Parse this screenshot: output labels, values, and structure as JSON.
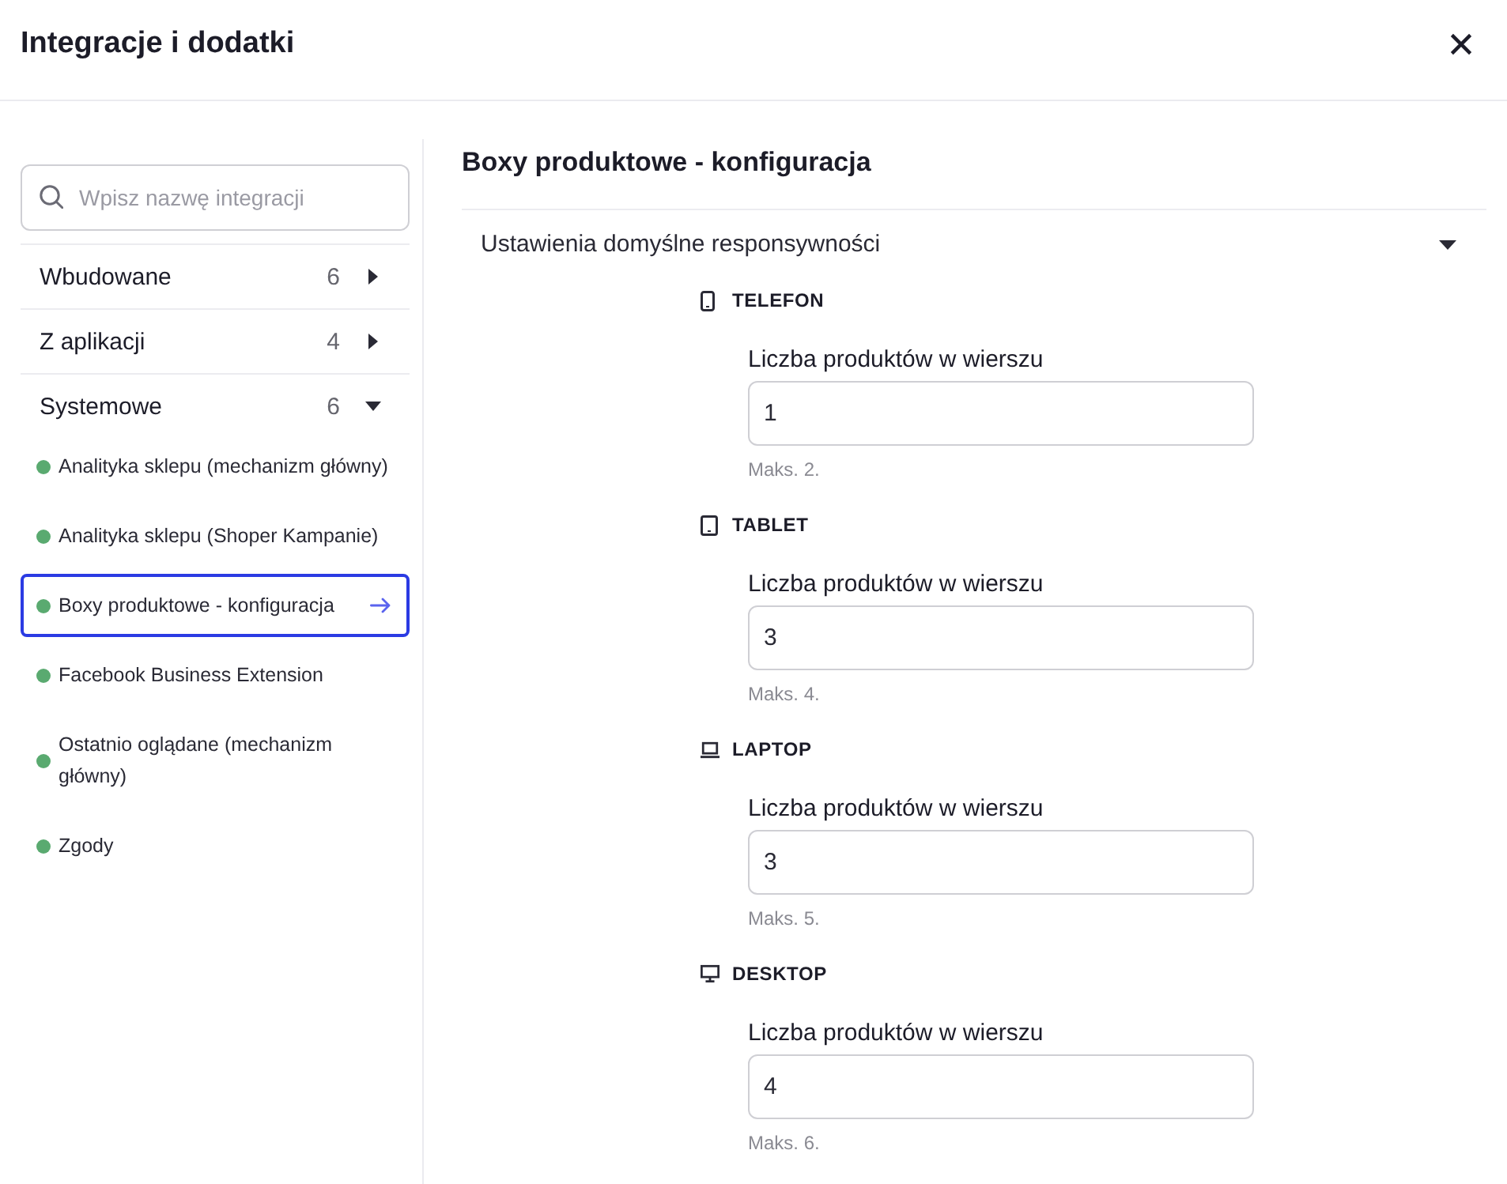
{
  "window": {
    "title": "Integracje i dodatki"
  },
  "sidebar": {
    "search": {
      "placeholder": "Wpisz nazwę integracji"
    },
    "categories": [
      {
        "label": "Wbudowane",
        "count": "6",
        "expanded": false
      },
      {
        "label": "Z aplikacji",
        "count": "4",
        "expanded": false
      },
      {
        "label": "Systemowe",
        "count": "6",
        "expanded": true,
        "children": [
          {
            "label": "Analityka sklepu (mechanizm główny)",
            "selected": false
          },
          {
            "label": "Analityka sklepu (Shoper Kampanie)",
            "selected": false
          },
          {
            "label": "Boxy produktowe - konfiguracja",
            "selected": true
          },
          {
            "label": "Facebook Business Extension",
            "selected": false
          },
          {
            "label": "Ostatnio oglądane (mechanizm główny)",
            "selected": false
          },
          {
            "label": "Zgody",
            "selected": false
          }
        ]
      }
    ]
  },
  "main": {
    "title": "Boxy produktowe - konfiguracja",
    "section": {
      "title": "Ustawienia domyślne responsywności",
      "expanded": true,
      "devices": [
        {
          "kind": "phone",
          "label": "TELEFON",
          "field_label": "Liczba produktów w wierszu",
          "value": "1",
          "hint": "Maks. 2."
        },
        {
          "kind": "tablet",
          "label": "TABLET",
          "field_label": "Liczba produktów w wierszu",
          "value": "3",
          "hint": "Maks. 4."
        },
        {
          "kind": "laptop",
          "label": "LAPTOP",
          "field_label": "Liczba produktów w wierszu",
          "value": "3",
          "hint": "Maks. 5."
        },
        {
          "kind": "desktop",
          "label": "DESKTOP",
          "field_label": "Liczba produktów w wierszu",
          "value": "4",
          "hint": "Maks. 6."
        }
      ]
    }
  }
}
